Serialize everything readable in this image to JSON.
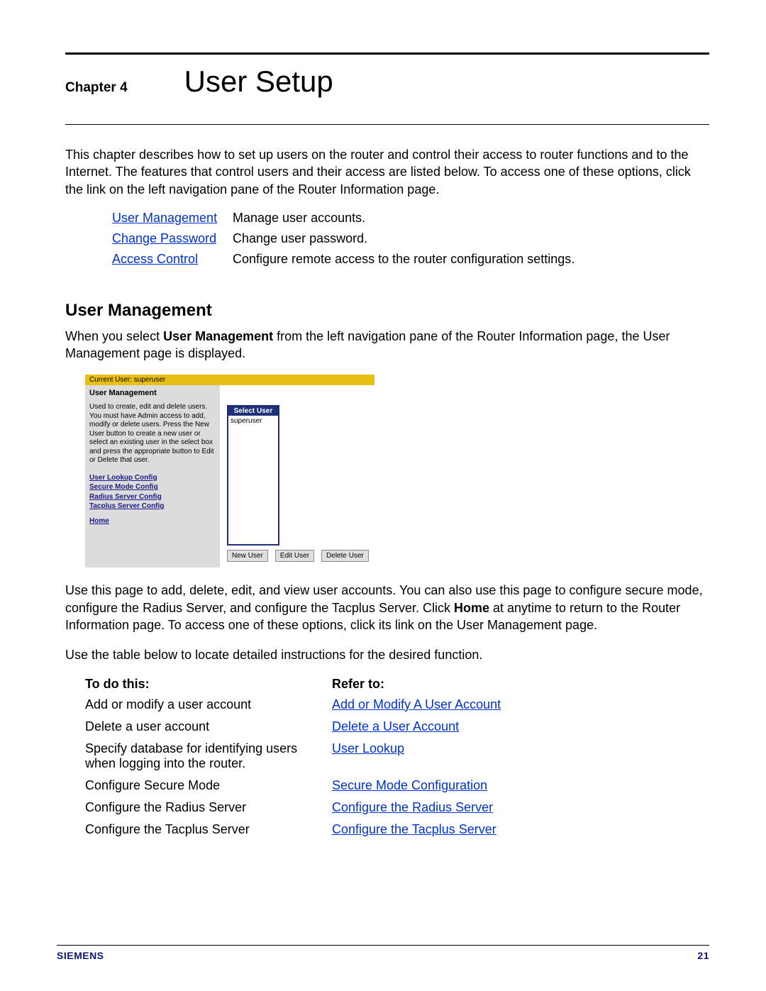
{
  "chapter": {
    "label": "Chapter 4",
    "title": "User Setup"
  },
  "intro": "This chapter describes how to set up users on the router and control their access to router functions and to the Internet. The features that control users and their access are listed below. To access one of these options, click the link on the left navigation pane of the Router Information page.",
  "features": [
    {
      "link": "User Management",
      "desc": "Manage user accounts."
    },
    {
      "link": "Change Password",
      "desc": "Change user password."
    },
    {
      "link": "Access Control",
      "desc": "Configure remote access to the router configuration settings."
    }
  ],
  "section_heading": "User Management",
  "section_intro_pre": "When you select ",
  "section_intro_bold": "User Management",
  "section_intro_post": " from the left navigation pane of the Router Information page, the User Management page is displayed.",
  "screenshot": {
    "current_user_label": "Current User: superuser",
    "heading": "User Management",
    "desc": "Used to create, edit and delete users. You must have Admin access to add, modify or delete users. Press the New User button to create a new user or select an existing user in the select box and press the appropriate button to Edit or Delete that user.",
    "links": [
      "User Lookup Config",
      "Secure Mode Config",
      "Radius Server Config",
      "Tacplus Server Config"
    ],
    "home": "Home",
    "select_label": "Select User",
    "select_item": "superuser",
    "buttons": [
      "New User",
      "Edit User",
      "Delete User"
    ]
  },
  "post_screenshot_1_pre": "Use this page to add, delete, edit, and view user accounts. You can also use this page to configure secure mode, configure the Radius Server, and configure the Tacplus Server. Click ",
  "post_screenshot_1_bold": "Home",
  "post_screenshot_1_post": " at anytime to return to the Router Information page. To access one of these options, click its link on the User Management page.",
  "post_screenshot_2": "Use the table below to locate detailed instructions for the desired function.",
  "task_head": {
    "col1": "To do this:",
    "col2": "Refer to:"
  },
  "tasks": [
    {
      "todo": "Add or modify a user account",
      "refer": "Add or Modify A User Account"
    },
    {
      "todo": "Delete a user account",
      "refer": "Delete a User Account"
    },
    {
      "todo": "Specify database for identifying users when logging into the router.",
      "refer": "User Lookup"
    },
    {
      "todo": "Configure Secure Mode",
      "refer": "Secure Mode Configuration"
    },
    {
      "todo": "Configure the Radius Server",
      "refer": "Configure the Radius Server"
    },
    {
      "todo": "Configure the Tacplus Server",
      "refer": "Configure the Tacplus Server"
    }
  ],
  "footer": {
    "brand": "SIEMENS",
    "page": "21"
  }
}
